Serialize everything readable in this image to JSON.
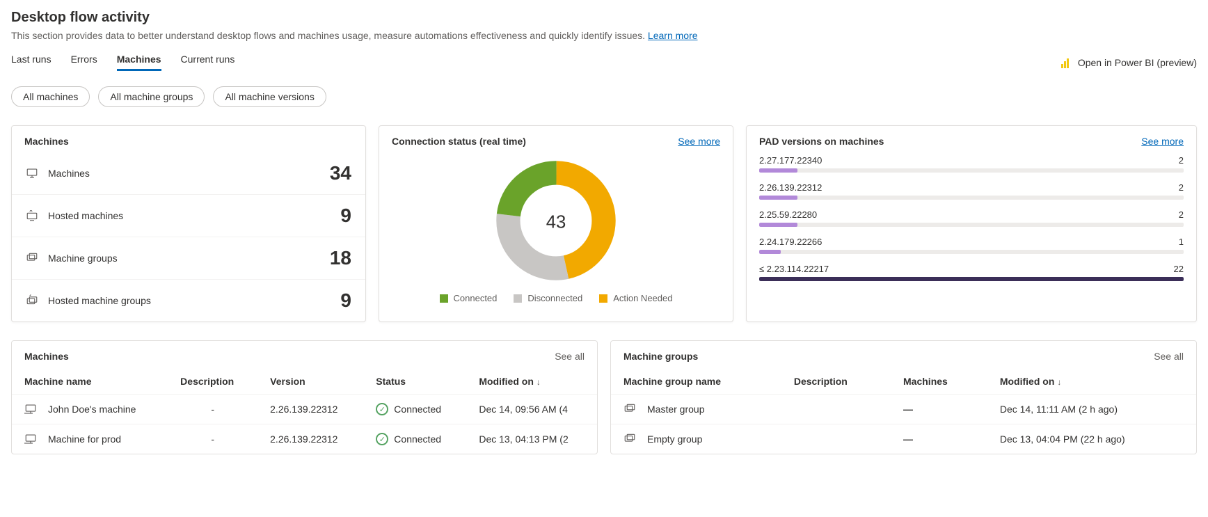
{
  "header": {
    "title": "Desktop flow activity",
    "subtitle": "This section provides data to better understand desktop flows and machines usage, measure automations effectiveness and quickly identify issues. ",
    "learn_more": "Learn more",
    "powerbi": "Open in Power BI (preview)"
  },
  "tabs": {
    "last_runs": "Last runs",
    "errors": "Errors",
    "machines": "Machines",
    "current_runs": "Current runs"
  },
  "filters": {
    "all_machines": "All machines",
    "all_groups": "All machine groups",
    "all_versions": "All machine versions"
  },
  "metrics_card": {
    "title": "Machines",
    "rows": [
      {
        "label": "Machines",
        "value": "34"
      },
      {
        "label": "Hosted machines",
        "value": "9"
      },
      {
        "label": "Machine groups",
        "value": "18"
      },
      {
        "label": "Hosted machine groups",
        "value": "9"
      }
    ]
  },
  "donut_card": {
    "title": "Connection status (real time)",
    "see_more": "See more",
    "center": "43",
    "legend": {
      "connected": "Connected",
      "disconnected": "Disconnected",
      "action": "Action Needed"
    }
  },
  "chart_data": {
    "type": "pie",
    "title": "Connection status (real time)",
    "total": 43,
    "series": [
      {
        "name": "Connected",
        "value": 10,
        "color": "#6aa32a"
      },
      {
        "name": "Disconnected",
        "value": 13,
        "color": "#c8c6c4"
      },
      {
        "name": "Action Needed",
        "value": 20,
        "color": "#f2a900"
      }
    ]
  },
  "pad_card": {
    "title": "PAD versions on machines",
    "see_more": "See more",
    "rows": [
      {
        "label": "2.27.177.22340",
        "value": "2",
        "color": "#b289d9",
        "pct": 9
      },
      {
        "label": "2.26.139.22312",
        "value": "2",
        "color": "#b289d9",
        "pct": 9
      },
      {
        "label": "2.25.59.22280",
        "value": "2",
        "color": "#b289d9",
        "pct": 9
      },
      {
        "label": "2.24.179.22266",
        "value": "1",
        "color": "#b289d9",
        "pct": 5
      },
      {
        "label": "≤ 2.23.114.22217",
        "value": "22",
        "color": "#3b2e58",
        "pct": 100
      }
    ]
  },
  "machines_table": {
    "title": "Machines",
    "see_all": "See all",
    "cols": {
      "name": "Machine name",
      "desc": "Description",
      "ver": "Version",
      "status": "Status",
      "mod": "Modified on"
    },
    "rows": [
      {
        "name": "John Doe's machine",
        "desc": "-",
        "ver": "2.26.139.22312",
        "status": "Connected",
        "mod": "Dec 14, 09:56 AM (4"
      },
      {
        "name": "Machine for prod",
        "desc": "-",
        "ver": "2.26.139.22312",
        "status": "Connected",
        "mod": "Dec 13, 04:13 PM (2"
      }
    ]
  },
  "groups_table": {
    "title": "Machine groups",
    "see_all": "See all",
    "cols": {
      "name": "Machine group name",
      "desc": "Description",
      "mach": "Machines",
      "mod": "Modified on"
    },
    "rows": [
      {
        "name": "Master group",
        "desc": "",
        "mach": "—",
        "mod": "Dec 14, 11:11 AM (2 h ago)"
      },
      {
        "name": "Empty group",
        "desc": "",
        "mach": "—",
        "mod": "Dec 13, 04:04 PM (22 h ago)"
      }
    ]
  }
}
